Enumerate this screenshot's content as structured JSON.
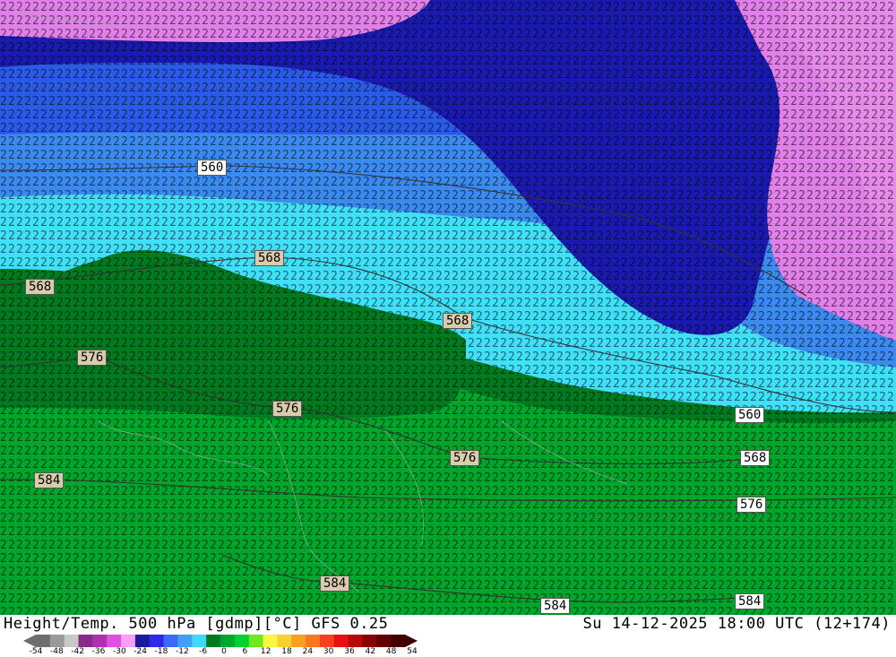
{
  "title": "Height/Temp. 500 hPa [gdmp][°C] GFS 0.25",
  "valid_time": "Su 14-12-2025 18:00 UTC (12+174)",
  "contour_labels": [
    "560",
    "568",
    "568",
    "568",
    "576",
    "576",
    "576",
    "584",
    "584",
    "560",
    "568",
    "576",
    "584",
    "584"
  ],
  "colorbar": {
    "ticks": [
      "-54",
      "-48",
      "-42",
      "-36",
      "-30",
      "-24",
      "-18",
      "-12",
      "-6",
      "0",
      "6",
      "12",
      "18",
      "24",
      "30",
      "36",
      "42",
      "48",
      "54"
    ],
    "colors": [
      "#6e6e6e",
      "#9a9a9a",
      "#c8c8c8",
      "#8a2a8a",
      "#b030b0",
      "#e050e0",
      "#f8a0f8",
      "#1a1aa0",
      "#2a2ae8",
      "#3a6af8",
      "#40a0f8",
      "#40d8f8",
      "#007a20",
      "#00a82a",
      "#00d030",
      "#70e820",
      "#f8f840",
      "#f8d030",
      "#f8a020",
      "#f87820",
      "#f84020",
      "#e81010",
      "#b80808",
      "#880404",
      "#600000",
      "#400000"
    ]
  },
  "legend": {
    "colors": {
      "dark_blue": "#1a1ab0",
      "violet": "#e080e8",
      "light_blue": "#3a78f0",
      "cyan": "#40e0f8",
      "dark_green": "#007a20",
      "green": "#00a52c",
      "bright_green": "#00c832"
    }
  }
}
